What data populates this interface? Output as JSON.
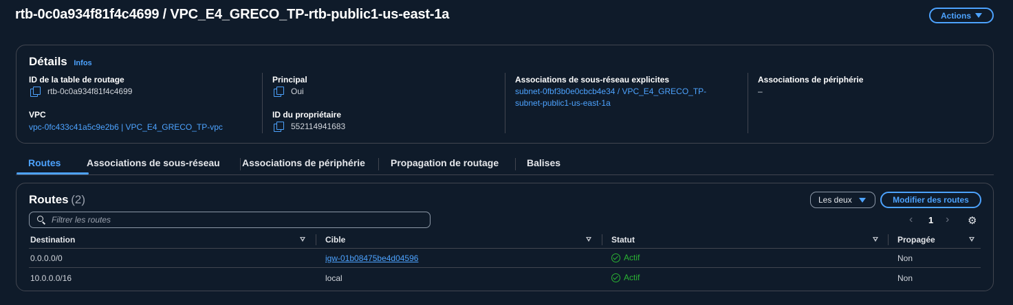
{
  "header": {
    "title": "rtb-0c0a934f81f4c4699 / VPC_E4_GRECO_TP-rtb-public1-us-east-1a",
    "actions_label": "Actions"
  },
  "details": {
    "title": "Détails",
    "info_link": "Infos",
    "route_table_id_label": "ID de la table de routage",
    "route_table_id": "rtb-0c0a934f81f4c4699",
    "vpc_label": "VPC",
    "vpc_value": "vpc-0fc433c41a5c9e2b6 | VPC_E4_GRECO_TP-vpc",
    "main_label": "Principal",
    "main_value": "Oui",
    "owner_label": "ID du propriétaire",
    "owner_value": "552114941683",
    "explicit_assoc_label": "Associations de sous-réseau explicites",
    "explicit_assoc_line1": "subnet-0fbf3b0e0cbcb4e34 / VPC_E4_GRECO_TP-",
    "explicit_assoc_line2": "subnet-public1-us-east-1a",
    "edge_assoc_label": "Associations de périphérie",
    "edge_assoc_value": "–"
  },
  "tabs": [
    {
      "label": "Routes",
      "active": true
    },
    {
      "label": "Associations de sous-réseau",
      "active": false
    },
    {
      "label": "Associations de périphérie",
      "active": false
    },
    {
      "label": "Propagation de routage",
      "active": false
    },
    {
      "label": "Balises",
      "active": false
    }
  ],
  "routes": {
    "title": "Routes",
    "count": "(2)",
    "filter_value": "Les deux",
    "modify_label": "Modifier des routes",
    "search_placeholder": "Filtrer les routes",
    "page": "1",
    "columns": [
      "Destination",
      "Cible",
      "Statut",
      "Propagée"
    ],
    "rows": [
      {
        "destination": "0.0.0.0/0",
        "target": "igw-01b08475be4d04596",
        "status": "Actif",
        "propagated": "Non"
      },
      {
        "destination": "10.0.0.0/16",
        "target": "local",
        "status": "Actif",
        "propagated": "Non"
      }
    ]
  },
  "colors": {
    "background": "#0f1b2a",
    "accent": "#4da3ff",
    "success": "#2bb534",
    "border": "#424650"
  }
}
